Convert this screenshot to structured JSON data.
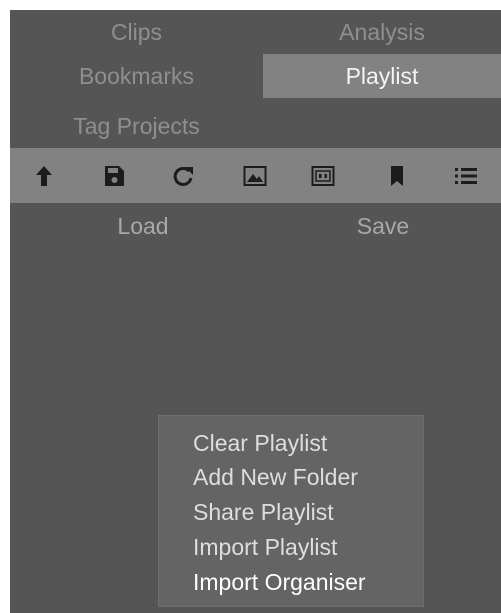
{
  "tabs": {
    "clips": "Clips",
    "analysis": "Analysis",
    "bookmarks": "Bookmarks",
    "playlist": "Playlist",
    "tag_projects": "Tag Projects",
    "active": "Playlist"
  },
  "toolbar": {
    "icons": [
      "upload-arrow-icon",
      "save-disk-icon",
      "refresh-icon",
      "image-icon",
      "film-frame-icon",
      "bookmark-icon",
      "list-icon"
    ]
  },
  "actions": {
    "load": "Load",
    "save": "Save"
  },
  "context_menu": {
    "items": [
      "Clear Playlist",
      "Add New Folder",
      "Share Playlist",
      "Import Playlist",
      "Import Organiser"
    ],
    "highlighted": "Import Organiser"
  },
  "colors": {
    "panel_bg": "#555555",
    "active_tab_bg": "#828282",
    "toolbar_bg": "#828282",
    "menu_bg": "#646464",
    "inactive_text": "#8f8f8f",
    "menu_text": "#dedede"
  }
}
